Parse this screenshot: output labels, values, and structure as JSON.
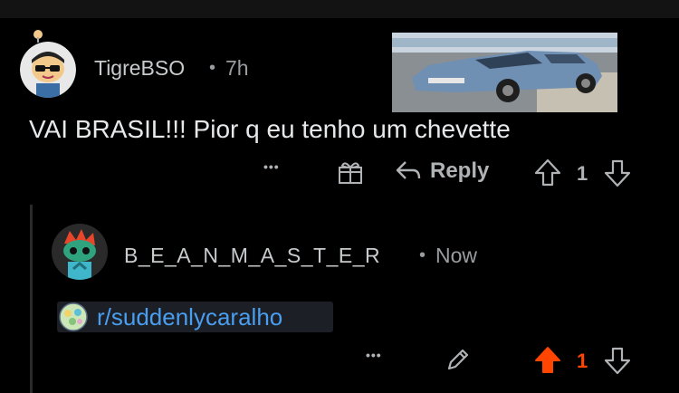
{
  "comments": [
    {
      "username": "TigreBSO",
      "separator": "•",
      "age": "7h",
      "text": "VAI BRASIL!!! Pior q eu tenho um chevette",
      "actions": {
        "more_label": "•••",
        "reply_label": "Reply",
        "score": "1"
      },
      "icons": {
        "more": "more-dots-icon",
        "award": "award-gift-icon",
        "reply": "reply-arrow-icon",
        "upvote": "upvote-outline-icon",
        "downvote": "downvote-outline-icon"
      }
    },
    {
      "username": "B_E_A_N_M_A_S_T_E_R",
      "separator": "•",
      "age": "Now",
      "link_text": "r/suddenlycaralho",
      "actions": {
        "more_label": "•••",
        "score": "1"
      },
      "icons": {
        "more": "more-dots-icon",
        "edit": "edit-pencil-icon",
        "upvote": "upvote-filled-icon",
        "downvote": "downvote-outline-icon"
      },
      "upvote_color": "#ff4500"
    }
  ],
  "colors": {
    "background": "#000000",
    "link": "#4a9eef",
    "upvote_active": "#ff4500"
  }
}
